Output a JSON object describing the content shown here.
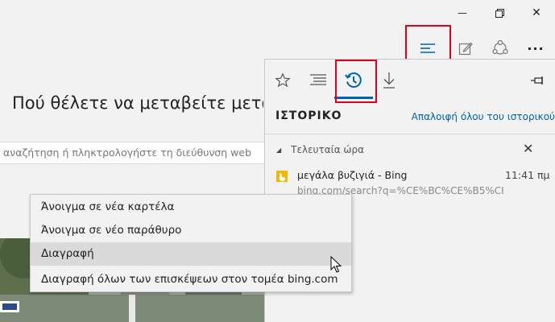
{
  "window": {
    "minimize_glyph": "—",
    "restore_icon": "restore-icon",
    "close_glyph": "✕"
  },
  "toolbar": {
    "hub_icon": "hub-icon",
    "webnote_icon": "web-note-icon",
    "share_icon": "share-icon",
    "more_glyph": "···"
  },
  "page": {
    "headline": "Πού θέλετε να μεταβείτε μετά;",
    "search_placeholder": "αναζήτηση ή πληκτρολογήστε τη διεύθυνση web"
  },
  "hub": {
    "tabs": [
      "favorites-icon",
      "reading-list-icon",
      "history-icon",
      "downloads-icon"
    ],
    "active_tab": "history",
    "pin_icon": "pin-icon",
    "title": "ΙΣΤΟΡΙΚΟ",
    "clear_all": "Απαλοιφή όλου του ιστορικού",
    "group": {
      "label": "Τελευταία ώρα",
      "entries": [
        {
          "title": "μεγάλα βυζιγιά - Bing",
          "time": "11:41 πμ",
          "url": "bing.com/search?q=%CE%BC%CE%B5%CI"
        }
      ]
    }
  },
  "context_menu": {
    "items": [
      "Άνοιγμα σε νέα καρτέλα",
      "Άνοιγμα σε νέο παράθυρο",
      "Διαγραφή",
      "Διαγραφή όλων των επισκέψεων στον τομέα bing.com"
    ],
    "hovered_index": 2
  },
  "colors": {
    "accent": "#0063b1",
    "highlight": "#e0001b",
    "bing": "#f5b800"
  }
}
